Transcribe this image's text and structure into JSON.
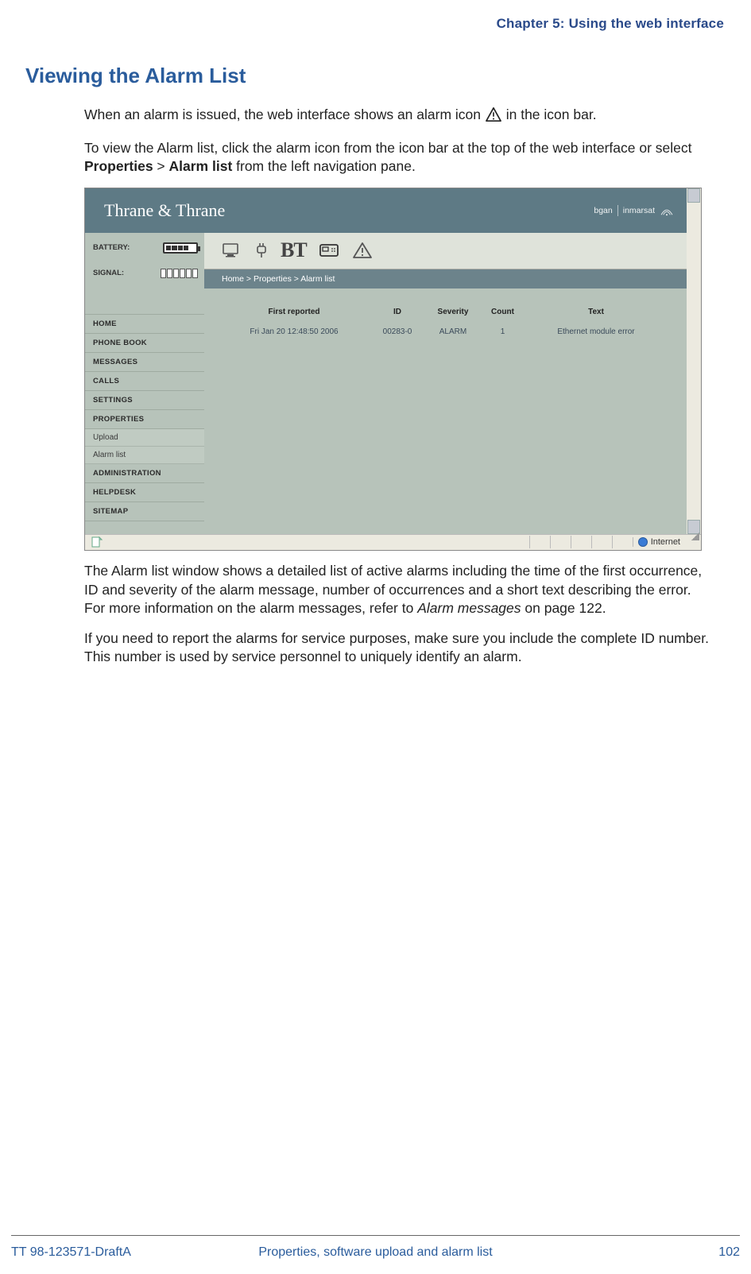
{
  "chapter": "Chapter 5: Using the web interface",
  "section_title": "Viewing the Alarm List",
  "para1_a": "When an alarm is issued, the web interface shows an alarm icon ",
  "para1_b": " in the icon bar.",
  "para2_a": "To view the Alarm list, click the alarm icon from the icon bar at the top of the web interface or select ",
  "para2_prop": "Properties",
  "para2_gt": " > ",
  "para2_alarm": "Alarm list",
  "para2_b": " from the left navigation pane.",
  "para3_a": "The Alarm list window shows a detailed list of active alarms including the time of the first occurrence, ID and severity of the alarm message, number of occurrences and a short text describing the error. For more information on the alarm messages, refer to ",
  "para3_ref": "Alarm messages",
  "para3_b": " on page 122.",
  "para4": "If you need to report the alarms for service purposes, make sure you include the complete ID number. This number is used by service personnel to uniquely identify an alarm.",
  "screenshot": {
    "brand": "Thrane & Thrane",
    "logo_left": "bgan",
    "logo_right": "inmarsat",
    "battery_label": "BATTERY:",
    "signal_label": "SIGNAL:",
    "nav": [
      "HOME",
      "PHONE BOOK",
      "MESSAGES",
      "CALLS",
      "SETTINGS",
      "PROPERTIES"
    ],
    "nav_sub": [
      "Upload",
      "Alarm list"
    ],
    "nav2": [
      "ADMINISTRATION",
      "HELPDESK",
      "SITEMAP"
    ],
    "breadcrumb": "Home > Properties > Alarm list",
    "table": {
      "headers": {
        "first": "First reported",
        "id": "ID",
        "severity": "Severity",
        "count": "Count",
        "text": "Text"
      },
      "row": {
        "first": "Fri Jan 20 12:48:50 2006",
        "id": "00283-0",
        "severity": "ALARM",
        "count": "1",
        "text": "Ethernet module error"
      }
    },
    "status_zone": "Internet"
  },
  "footer": {
    "left": "TT 98-123571-DraftA",
    "center": "Properties, software upload and alarm list",
    "right": "102"
  }
}
